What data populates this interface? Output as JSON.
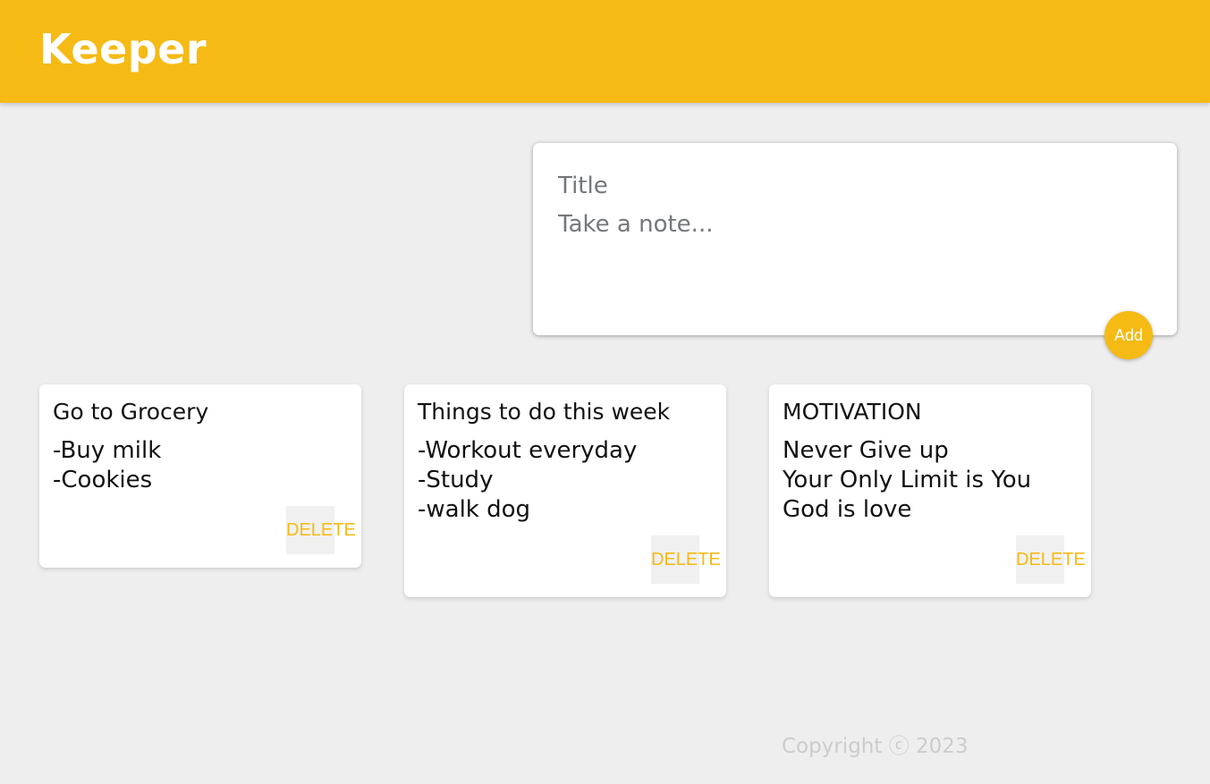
{
  "header": {
    "title": "Keeper"
  },
  "create_note": {
    "title_placeholder": "Title",
    "content_placeholder": "Take a note...",
    "add_label": "Add"
  },
  "notes": [
    {
      "title": "Go to Grocery",
      "content": "-Buy milk\n-Cookies",
      "delete_label": "DELETE"
    },
    {
      "title": "Things to do this week",
      "content": "-Workout everyday\n-Study\n-walk dog",
      "delete_label": "DELETE"
    },
    {
      "title": "MOTIVATION",
      "content": "Never Give up\nYour Only Limit is You\nGod is love",
      "delete_label": "DELETE"
    }
  ],
  "footer": {
    "copyright": "Copyright ⓒ 2023"
  },
  "colors": {
    "accent": "#f5ba13",
    "background": "#eeeeee",
    "card": "#ffffff"
  }
}
